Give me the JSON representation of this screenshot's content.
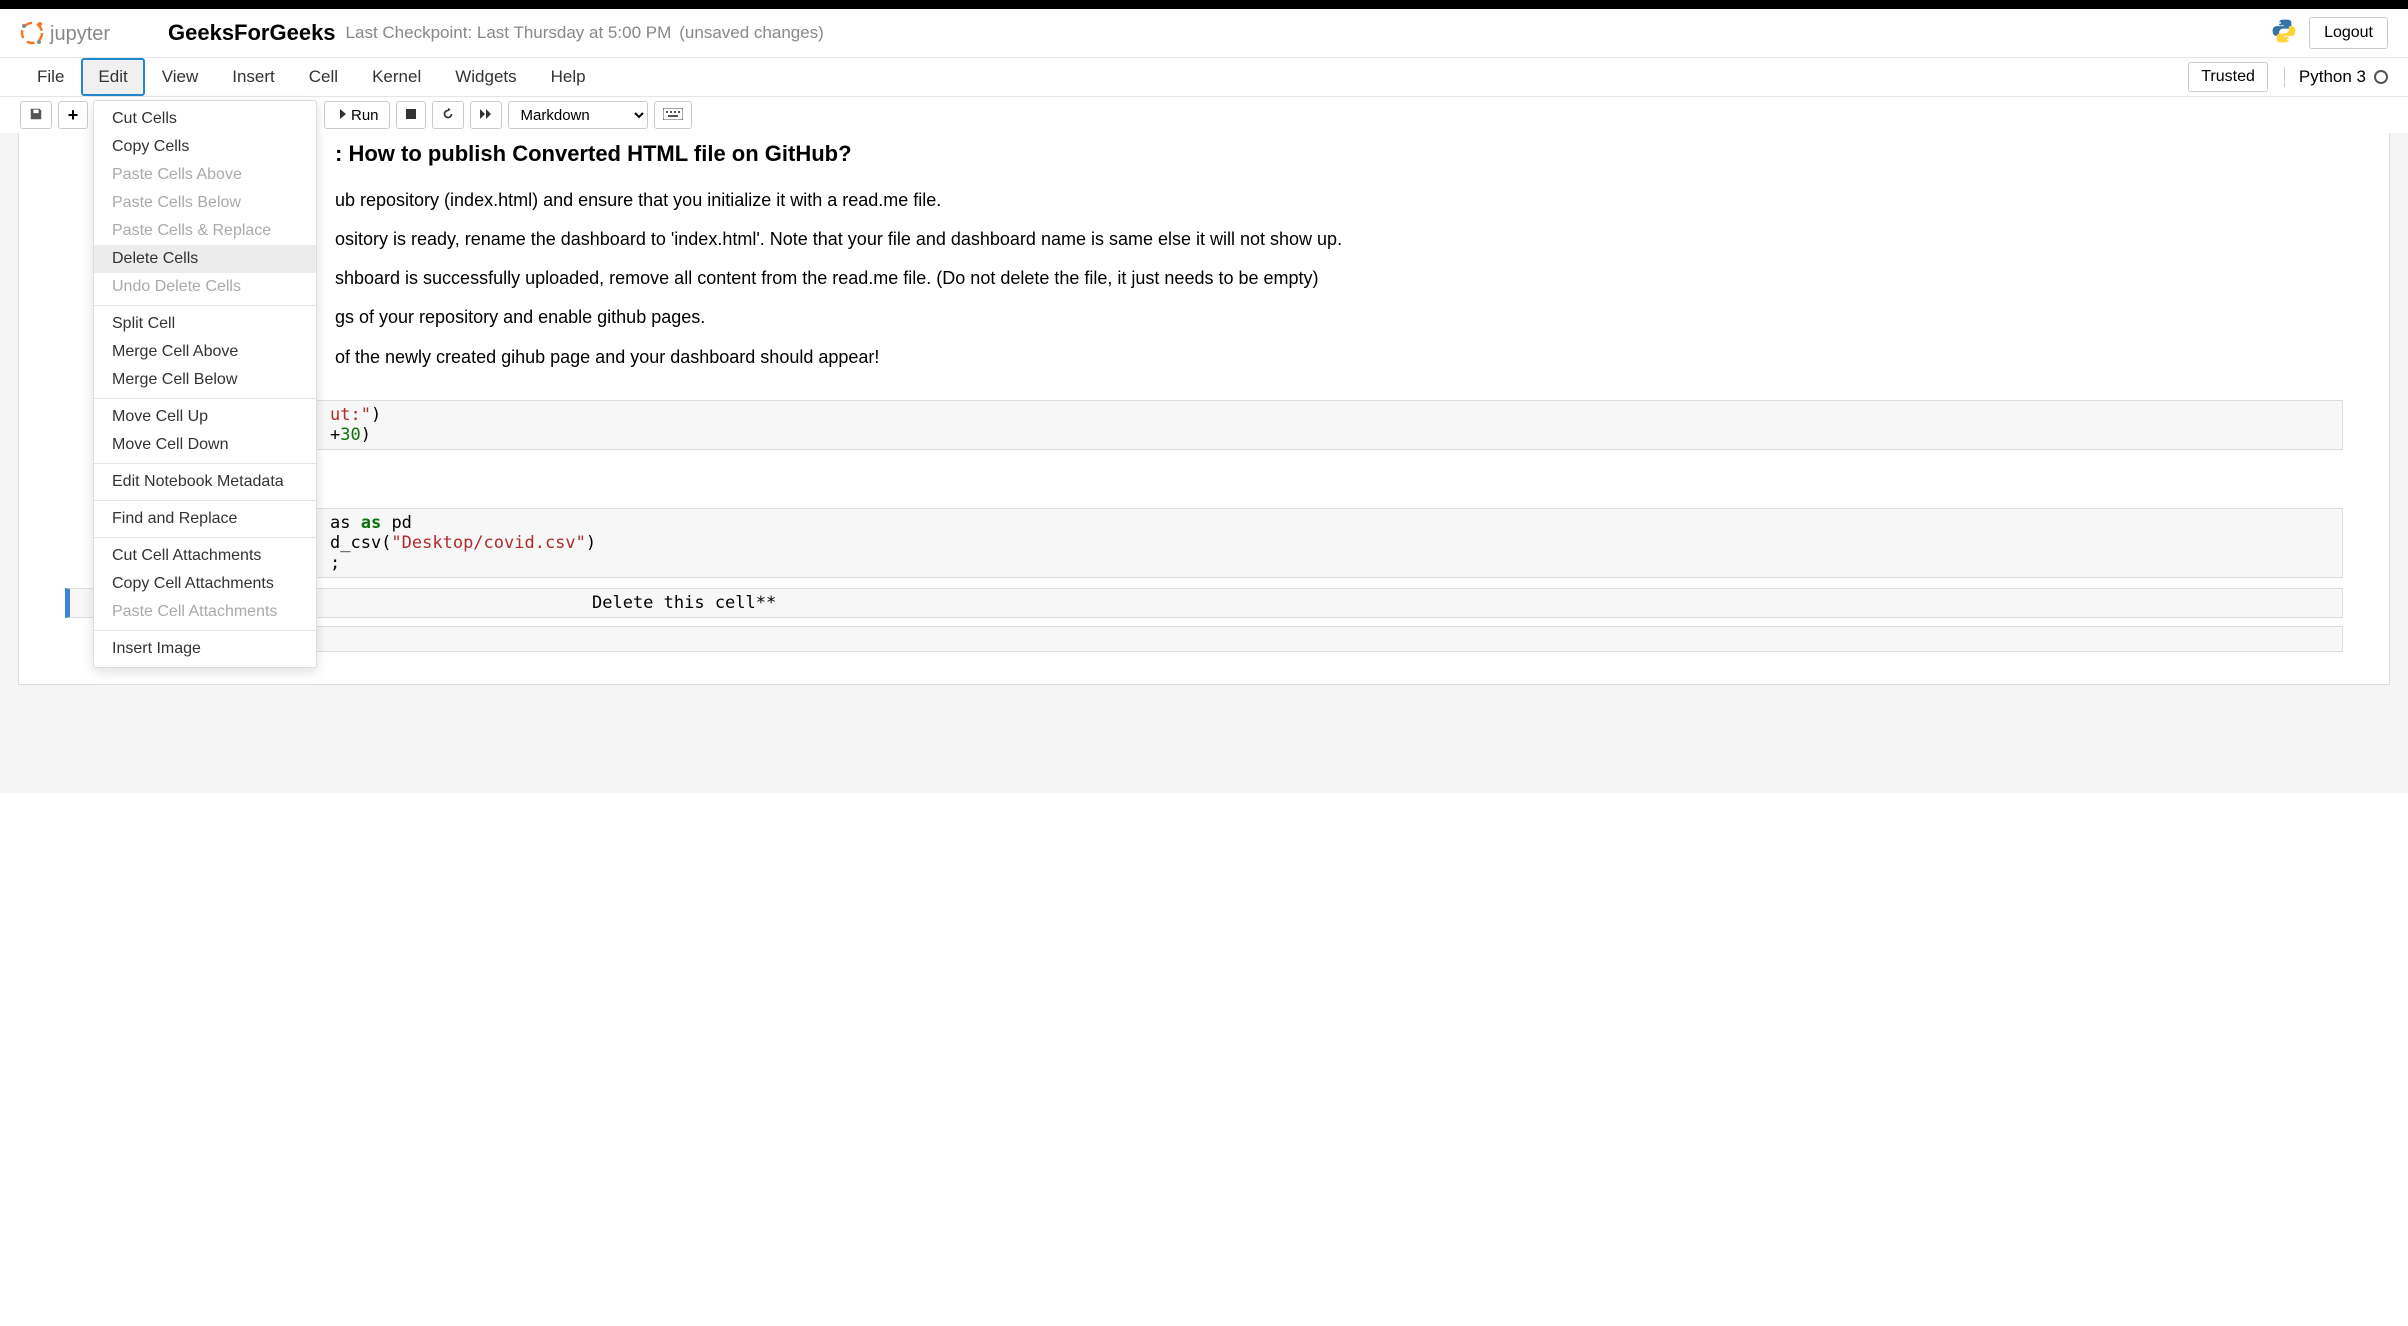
{
  "header": {
    "notebook_name": "GeeksForGeeks",
    "checkpoint": "Last Checkpoint: Last Thursday at 5:00 PM",
    "unsaved": "(unsaved changes)",
    "logout": "Logout"
  },
  "menubar": {
    "items": [
      "File",
      "Edit",
      "View",
      "Insert",
      "Cell",
      "Kernel",
      "Widgets",
      "Help"
    ],
    "trusted": "Trusted",
    "kernel_name": "Python 3"
  },
  "toolbar": {
    "run": "Run",
    "celltype": "Markdown"
  },
  "edit_menu": {
    "items": [
      {
        "label": "Cut Cells",
        "disabled": false
      },
      {
        "label": "Copy Cells",
        "disabled": false
      },
      {
        "label": "Paste Cells Above",
        "disabled": true
      },
      {
        "label": "Paste Cells Below",
        "disabled": true
      },
      {
        "label": "Paste Cells & Replace",
        "disabled": true
      },
      {
        "label": "Delete Cells",
        "disabled": false,
        "hover": true
      },
      {
        "label": "Undo Delete Cells",
        "disabled": true
      },
      {
        "divider": true
      },
      {
        "label": "Split Cell",
        "disabled": false
      },
      {
        "label": "Merge Cell Above",
        "disabled": false
      },
      {
        "label": "Merge Cell Below",
        "disabled": false
      },
      {
        "divider": true
      },
      {
        "label": "Move Cell Up",
        "disabled": false
      },
      {
        "label": "Move Cell Down",
        "disabled": false
      },
      {
        "divider": true
      },
      {
        "label": "Edit Notebook Metadata",
        "disabled": false
      },
      {
        "divider": true
      },
      {
        "label": "Find and Replace",
        "disabled": false
      },
      {
        "divider": true
      },
      {
        "label": "Cut Cell Attachments",
        "disabled": false
      },
      {
        "label": "Copy Cell Attachments",
        "disabled": false
      },
      {
        "label": "Paste Cell Attachments",
        "disabled": true
      },
      {
        "divider": true
      },
      {
        "label": "Insert Image",
        "disabled": false
      }
    ]
  },
  "content": {
    "heading_partial": ": How to publish Converted HTML file on GitHub?",
    "steps": [
      "ub repository (index.html) and ensure that you initialize it with a read.me file.",
      "ository is ready, rename the dashboard to 'index.html'. Note that your file and dashboard name is same else it will not show up.",
      "shboard is successfully uploaded, remove all content from the read.me file. (Do not delete the file, it just needs to be empty)",
      "gs of your repository and enable github pages.",
      "of the newly created gihub page and your dashboard should appear!"
    ],
    "code1_line1_a": "ut:\"",
    "code1_line1_b": ")",
    "code1_line2_a": "+",
    "code1_line2_b": "30",
    "code1_line2_c": ")",
    "code2_line1_a": "as ",
    "code2_line1_b": "as",
    "code2_line1_c": " pd",
    "code2_line2_a": "d_csv(",
    "code2_line2_b": "\"Desktop/covid.csv\"",
    "code2_line2_c": ")",
    "code2_line3": ";",
    "code3_line1": "Delete this cell**"
  }
}
